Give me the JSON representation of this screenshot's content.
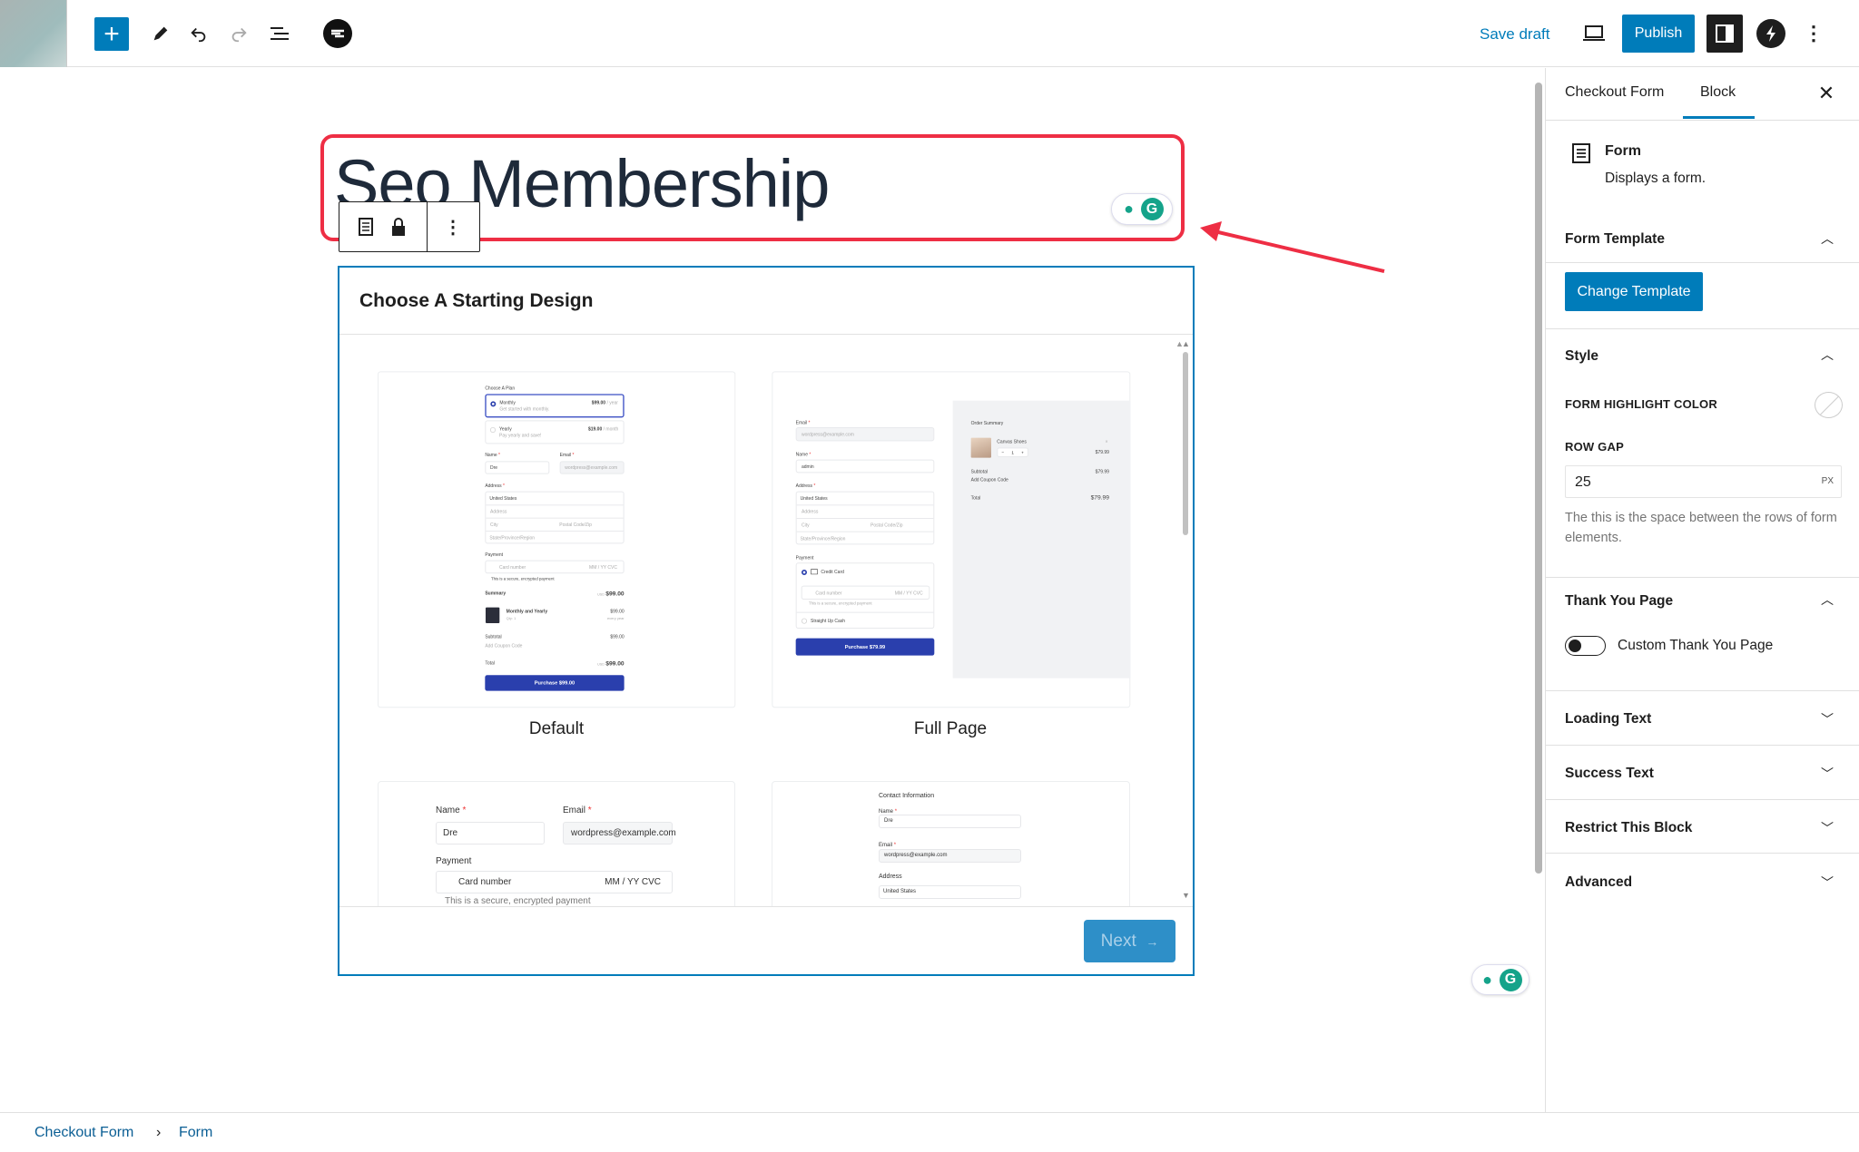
{
  "toolbar": {
    "save_draft": "Save draft",
    "publish": "Publish",
    "icons": [
      "plus-icon",
      "pencil-icon",
      "undo-icon",
      "redo-icon",
      "list-view-icon",
      "brand-logo-icon",
      "laptop-preview-icon",
      "sidebar-toggle-icon",
      "bolt-icon",
      "more-vertical-icon"
    ]
  },
  "editor": {
    "title": "Seo Membership",
    "annotation_color": "#ee2e44"
  },
  "form_block": {
    "heading": "Choose A Starting Design",
    "next": "Next",
    "next_arrow": "→",
    "templates": [
      {
        "label": "Default"
      },
      {
        "label": "Full Page"
      }
    ],
    "preview_default": {
      "choose_plan": "Choose A Plan",
      "plans": [
        {
          "name": "Monthly",
          "desc": "Get started with monthly.",
          "price": "$99.00",
          "period": "/ year"
        },
        {
          "name": "Yearly",
          "desc": "Pay yearly and save!",
          "price": "$19.00",
          "period": "/ month"
        }
      ],
      "name_label": "Name",
      "name_value": "Dre",
      "email_label": "Email",
      "email_placeholder": "wordpress@example.com",
      "address_label": "Address",
      "country": "United States",
      "address_ph": "Address",
      "city_ph": "City",
      "zip_ph": "Postal Code/Zip",
      "state_ph": "State/Province/Region",
      "payment_label": "Payment",
      "card_ph": "Card number",
      "card_exp": "MM / YY  CVC",
      "secure": "This is a secure, encrypted payment",
      "summary": "Summary",
      "currency": "USD",
      "amount": "$99.00",
      "item_name": "Monthly and Yearly",
      "item_qty": "Qty: 1",
      "item_price": "$99.00",
      "item_period": "every year",
      "subtotal": "Subtotal",
      "subtotal_amount": "$99.00",
      "coupon": "Add Coupon Code",
      "total": "Total",
      "total_amount": "$99.00",
      "purchase": "Purchase $99.00"
    },
    "preview_full": {
      "email_label": "Email",
      "email_placeholder": "wordpress@example.com",
      "name_label": "Name",
      "name_value": "admin",
      "address_label": "Address",
      "country": "United States",
      "address_ph": "Address",
      "city_ph": "City",
      "zip_ph": "Postal Code/Zip",
      "state_ph": "State/Province/Region",
      "payment_label": "Payment",
      "credit_card": "Credit Card",
      "card_ph": "Card number",
      "card_exp": "MM / YY  CVC",
      "secure": "This is a secure, encrypted payment",
      "cash": "Straight Up Cash",
      "purchase": "Purchase $79.99",
      "order_summary": "Order Summary",
      "product": "Canvas Shoes",
      "qty": "1",
      "price": "$79.99",
      "subtotal": "Subtotal",
      "subtotal_amount": "$79.99",
      "coupon": "Add Coupon Code",
      "total": "Total",
      "total_amount": "$79.99"
    },
    "preview_3": {
      "name_label": "Name",
      "name_value": "Dre",
      "email_label": "Email",
      "email_placeholder": "wordpress@example.com",
      "payment_label": "Payment",
      "card_ph": "Card number",
      "card_exp": "MM / YY  CVC",
      "secure": "This is a secure, encrypted payment"
    },
    "preview_4": {
      "contact": "Contact Information",
      "name_label": "Name",
      "name_value": "Dre",
      "email_label": "Email",
      "email_placeholder": "wordpress@example.com",
      "address_label": "Address",
      "country": "United States"
    }
  },
  "sidebar": {
    "tabs": [
      {
        "label": "Checkout Form",
        "active": false
      },
      {
        "label": "Block",
        "active": true
      }
    ],
    "block_name": "Form",
    "block_desc": "Displays a form.",
    "form_template": {
      "title": "Form Template",
      "button": "Change Template"
    },
    "style": {
      "title": "Style",
      "highlight_label": "FORM HIGHLIGHT COLOR",
      "row_gap_label": "ROW GAP",
      "row_gap_value": "25",
      "row_gap_unit": "PX",
      "help": "The this is the space between the rows of form elements."
    },
    "thank_you": {
      "title": "Thank You Page",
      "toggle_label": "Custom Thank You Page",
      "toggle_on": false
    },
    "collapsed": [
      "Loading Text",
      "Success Text",
      "Restrict This Block",
      "Advanced"
    ]
  },
  "breadcrumb": {
    "items": [
      "Checkout Form",
      "Form"
    ],
    "separator": "›"
  },
  "colors": {
    "accent": "#007cba",
    "purchase": "#2a3fad",
    "annotation": "#ee2e44"
  }
}
